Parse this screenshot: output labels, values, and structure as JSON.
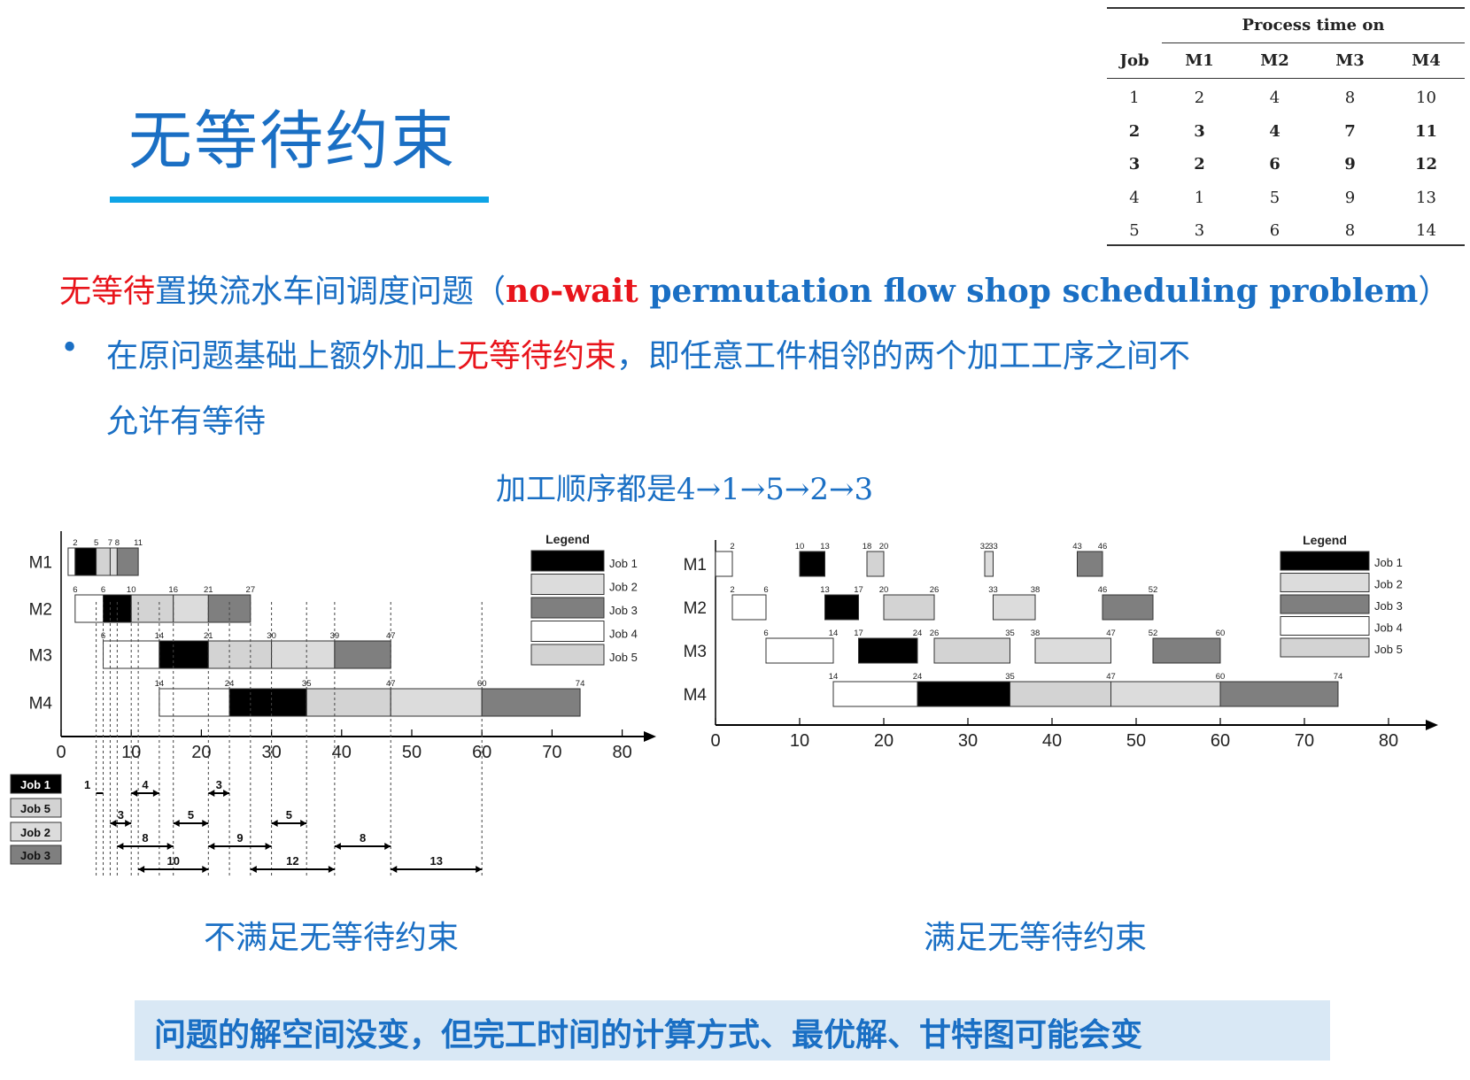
{
  "slide": {
    "title": "无等待约束",
    "line1_red": "无等待",
    "line1_mid": "置换流水车间调度问题（",
    "line1_red_en": "no-wait",
    "line1_blue_en": " permutation flow shop scheduling problem",
    "line1_close": "）",
    "bullet_symbol": "•",
    "bullet_part1": "在原问题基础上额外加上",
    "bullet_red": "无等待约束",
    "bullet_part2": "，即任意工件相邻的两个加工工序之间不",
    "bullet_cont": "允许有等待",
    "sequence": "加工顺序都是4→1→5→2→3",
    "caption_left": "不满足无等待约束",
    "caption_right": "满足无等待约束",
    "bottom_note": "问题的解空间没变，但完工时间的计算方式、最优解、甘特图可能会变"
  },
  "process_table": {
    "title": "Process time on",
    "headers": [
      "Job",
      "M1",
      "M2",
      "M3",
      "M4"
    ],
    "rows": [
      [
        "1",
        "2",
        "4",
        "8",
        "10"
      ],
      [
        "2",
        "3",
        "4",
        "7",
        "11"
      ],
      [
        "3",
        "2",
        "6",
        "9",
        "12"
      ],
      [
        "4",
        "1",
        "5",
        "9",
        "13"
      ],
      [
        "5",
        "3",
        "6",
        "8",
        "14"
      ]
    ]
  },
  "colors": {
    "accent": "#1a6fc4",
    "red": "#e8141b",
    "underline": "#0ea4e6",
    "note_bg": "#d9e8f5",
    "job1": "#000000",
    "job2": "#dcdcdc",
    "job3": "#7f7f7f",
    "job4": "#ffffff",
    "job5": "#d3d3d3"
  },
  "chart_data": [
    {
      "type": "gantt",
      "machines": [
        "M1",
        "M2",
        "M3",
        "M4"
      ],
      "x_ticks": [
        "0",
        "10",
        "20",
        "30",
        "40",
        "50",
        "60",
        "70",
        "80"
      ],
      "xlim": [
        0,
        80
      ],
      "legend_title": "Legend",
      "legend": [
        "Job 1",
        "Job 2",
        "Job 3",
        "Job 4",
        "Job 5"
      ],
      "tasks": [
        {
          "m": 0,
          "job": 4,
          "start": 1,
          "end": 2
        },
        {
          "m": 0,
          "job": 1,
          "start": 2,
          "end": 5
        },
        {
          "m": 0,
          "job": 5,
          "start": 5,
          "end": 7
        },
        {
          "m": 0,
          "job": 2,
          "start": 7,
          "end": 8
        },
        {
          "m": 0,
          "job": 3,
          "start": 8,
          "end": 11
        },
        {
          "m": 1,
          "job": 4,
          "start": 2,
          "end": 6
        },
        {
          "m": 1,
          "job": 1,
          "start": 6,
          "end": 10
        },
        {
          "m": 1,
          "job": 5,
          "start": 10,
          "end": 16
        },
        {
          "m": 1,
          "job": 2,
          "start": 16,
          "end": 21
        },
        {
          "m": 1,
          "job": 3,
          "start": 21,
          "end": 27
        },
        {
          "m": 2,
          "job": 4,
          "start": 6,
          "end": 14
        },
        {
          "m": 2,
          "job": 1,
          "start": 14,
          "end": 21
        },
        {
          "m": 2,
          "job": 5,
          "start": 21,
          "end": 30
        },
        {
          "m": 2,
          "job": 2,
          "start": 30,
          "end": 39
        },
        {
          "m": 2,
          "job": 3,
          "start": 39,
          "end": 47
        },
        {
          "m": 3,
          "job": 4,
          "start": 14,
          "end": 24
        },
        {
          "m": 3,
          "job": 1,
          "start": 24,
          "end": 35
        },
        {
          "m": 3,
          "job": 5,
          "start": 35,
          "end": 47
        },
        {
          "m": 3,
          "job": 2,
          "start": 47,
          "end": 60
        },
        {
          "m": 3,
          "job": 3,
          "start": 60,
          "end": 74
        }
      ],
      "labels": [
        {
          "m": 0,
          "x": 2,
          "t": "2"
        },
        {
          "m": 0,
          "x": 5,
          "t": "5"
        },
        {
          "m": 0,
          "x": 7,
          "t": "7"
        },
        {
          "m": 0,
          "x": 8,
          "t": "8"
        },
        {
          "m": 0,
          "x": 11,
          "t": "11"
        },
        {
          "m": 1,
          "x": 2,
          "t": "6"
        },
        {
          "m": 1,
          "x": 6,
          "t": "6"
        },
        {
          "m": 1,
          "x": 10,
          "t": "10"
        },
        {
          "m": 1,
          "x": 16,
          "t": "16"
        },
        {
          "m": 1,
          "x": 21,
          "t": "21"
        },
        {
          "m": 1,
          "x": 27,
          "t": "27"
        },
        {
          "m": 2,
          "x": 6,
          "t": "6"
        },
        {
          "m": 2,
          "x": 14,
          "t": "14"
        },
        {
          "m": 2,
          "x": 21,
          "t": "21"
        },
        {
          "m": 2,
          "x": 30,
          "t": "30"
        },
        {
          "m": 2,
          "x": 39,
          "t": "39"
        },
        {
          "m": 2,
          "x": 47,
          "t": "47"
        },
        {
          "m": 3,
          "x": 14,
          "t": "14"
        },
        {
          "m": 3,
          "x": 24,
          "t": "24"
        },
        {
          "m": 3,
          "x": 35,
          "t": "35"
        },
        {
          "m": 3,
          "x": 47,
          "t": "47"
        },
        {
          "m": 3,
          "x": 60,
          "t": "60"
        },
        {
          "m": 3,
          "x": 74,
          "t": "74"
        }
      ],
      "wait_legend": [
        "Job 1",
        "Job 5",
        "Job 2",
        "Job 3"
      ],
      "waits": [
        {
          "row": 0,
          "x1": 5,
          "x2": 6,
          "t": "1"
        },
        {
          "row": 0,
          "x1": 10,
          "x2": 14,
          "t": "4"
        },
        {
          "row": 0,
          "x1": 21,
          "x2": 24,
          "t": "3"
        },
        {
          "row": 1,
          "x1": 7,
          "x2": 10,
          "t": "3"
        },
        {
          "row": 1,
          "x1": 16,
          "x2": 21,
          "t": "5"
        },
        {
          "row": 1,
          "x1": 30,
          "x2": 35,
          "t": "5"
        },
        {
          "row": 2,
          "x1": 8,
          "x2": 16,
          "t": "8"
        },
        {
          "row": 2,
          "x1": 21,
          "x2": 30,
          "t": "9"
        },
        {
          "row": 2,
          "x1": 39,
          "x2": 47,
          "t": "8"
        },
        {
          "row": 3,
          "x1": 11,
          "x2": 21,
          "t": "10"
        },
        {
          "row": 3,
          "x1": 27,
          "x2": 39,
          "t": "12"
        },
        {
          "row": 3,
          "x1": 47,
          "x2": 60,
          "t": "13"
        }
      ]
    },
    {
      "type": "gantt",
      "machines": [
        "M1",
        "M2",
        "M3",
        "M4"
      ],
      "x_ticks": [
        "0",
        "10",
        "20",
        "30",
        "40",
        "50",
        "60",
        "70",
        "80"
      ],
      "xlim": [
        0,
        80
      ],
      "legend_title": "Legend",
      "legend": [
        "Job 1",
        "Job 2",
        "Job 3",
        "Job 4",
        "Job 5"
      ],
      "tasks": [
        {
          "m": 0,
          "job": 4,
          "start": 0,
          "end": 2
        },
        {
          "m": 0,
          "job": 1,
          "start": 10,
          "end": 13
        },
        {
          "m": 0,
          "job": 5,
          "start": 18,
          "end": 20
        },
        {
          "m": 0,
          "job": 2,
          "start": 32,
          "end": 33
        },
        {
          "m": 0,
          "job": 3,
          "start": 43,
          "end": 46
        },
        {
          "m": 1,
          "job": 4,
          "start": 2,
          "end": 6
        },
        {
          "m": 1,
          "job": 1,
          "start": 13,
          "end": 17
        },
        {
          "m": 1,
          "job": 5,
          "start": 20,
          "end": 26
        },
        {
          "m": 1,
          "job": 2,
          "start": 33,
          "end": 38
        },
        {
          "m": 1,
          "job": 3,
          "start": 46,
          "end": 52
        },
        {
          "m": 2,
          "job": 4,
          "start": 6,
          "end": 14
        },
        {
          "m": 2,
          "job": 1,
          "start": 17,
          "end": 24
        },
        {
          "m": 2,
          "job": 5,
          "start": 26,
          "end": 35
        },
        {
          "m": 2,
          "job": 2,
          "start": 38,
          "end": 47
        },
        {
          "m": 2,
          "job": 3,
          "start": 52,
          "end": 60
        },
        {
          "m": 3,
          "job": 4,
          "start": 14,
          "end": 24
        },
        {
          "m": 3,
          "job": 1,
          "start": 24,
          "end": 35
        },
        {
          "m": 3,
          "job": 5,
          "start": 35,
          "end": 47
        },
        {
          "m": 3,
          "job": 2,
          "start": 47,
          "end": 60
        },
        {
          "m": 3,
          "job": 3,
          "start": 60,
          "end": 74
        }
      ],
      "labels": [
        {
          "m": 0,
          "x": 2,
          "t": "2"
        },
        {
          "m": 0,
          "x": 10,
          "t": "10"
        },
        {
          "m": 0,
          "x": 13,
          "t": "13"
        },
        {
          "m": 0,
          "x": 18,
          "t": "18"
        },
        {
          "m": 0,
          "x": 20,
          "t": "20"
        },
        {
          "m": 0,
          "x": 32,
          "t": "32"
        },
        {
          "m": 0,
          "x": 33,
          "t": "33"
        },
        {
          "m": 0,
          "x": 43,
          "t": "43"
        },
        {
          "m": 0,
          "x": 46,
          "t": "46"
        },
        {
          "m": 1,
          "x": 2,
          "t": "2"
        },
        {
          "m": 1,
          "x": 6,
          "t": "6"
        },
        {
          "m": 1,
          "x": 13,
          "t": "13"
        },
        {
          "m": 1,
          "x": 17,
          "t": "17"
        },
        {
          "m": 1,
          "x": 20,
          "t": "20"
        },
        {
          "m": 1,
          "x": 26,
          "t": "26"
        },
        {
          "m": 1,
          "x": 33,
          "t": "33"
        },
        {
          "m": 1,
          "x": 38,
          "t": "38"
        },
        {
          "m": 1,
          "x": 46,
          "t": "46"
        },
        {
          "m": 1,
          "x": 52,
          "t": "52"
        },
        {
          "m": 2,
          "x": 6,
          "t": "6"
        },
        {
          "m": 2,
          "x": 14,
          "t": "14"
        },
        {
          "m": 2,
          "x": 17,
          "t": "17"
        },
        {
          "m": 2,
          "x": 24,
          "t": "24"
        },
        {
          "m": 2,
          "x": 26,
          "t": "26"
        },
        {
          "m": 2,
          "x": 35,
          "t": "35"
        },
        {
          "m": 2,
          "x": 38,
          "t": "38"
        },
        {
          "m": 2,
          "x": 47,
          "t": "47"
        },
        {
          "m": 2,
          "x": 52,
          "t": "52"
        },
        {
          "m": 2,
          "x": 60,
          "t": "60"
        },
        {
          "m": 3,
          "x": 14,
          "t": "14"
        },
        {
          "m": 3,
          "x": 24,
          "t": "24"
        },
        {
          "m": 3,
          "x": 35,
          "t": "35"
        },
        {
          "m": 3,
          "x": 47,
          "t": "47"
        },
        {
          "m": 3,
          "x": 60,
          "t": "60"
        },
        {
          "m": 3,
          "x": 74,
          "t": "74"
        }
      ]
    }
  ]
}
